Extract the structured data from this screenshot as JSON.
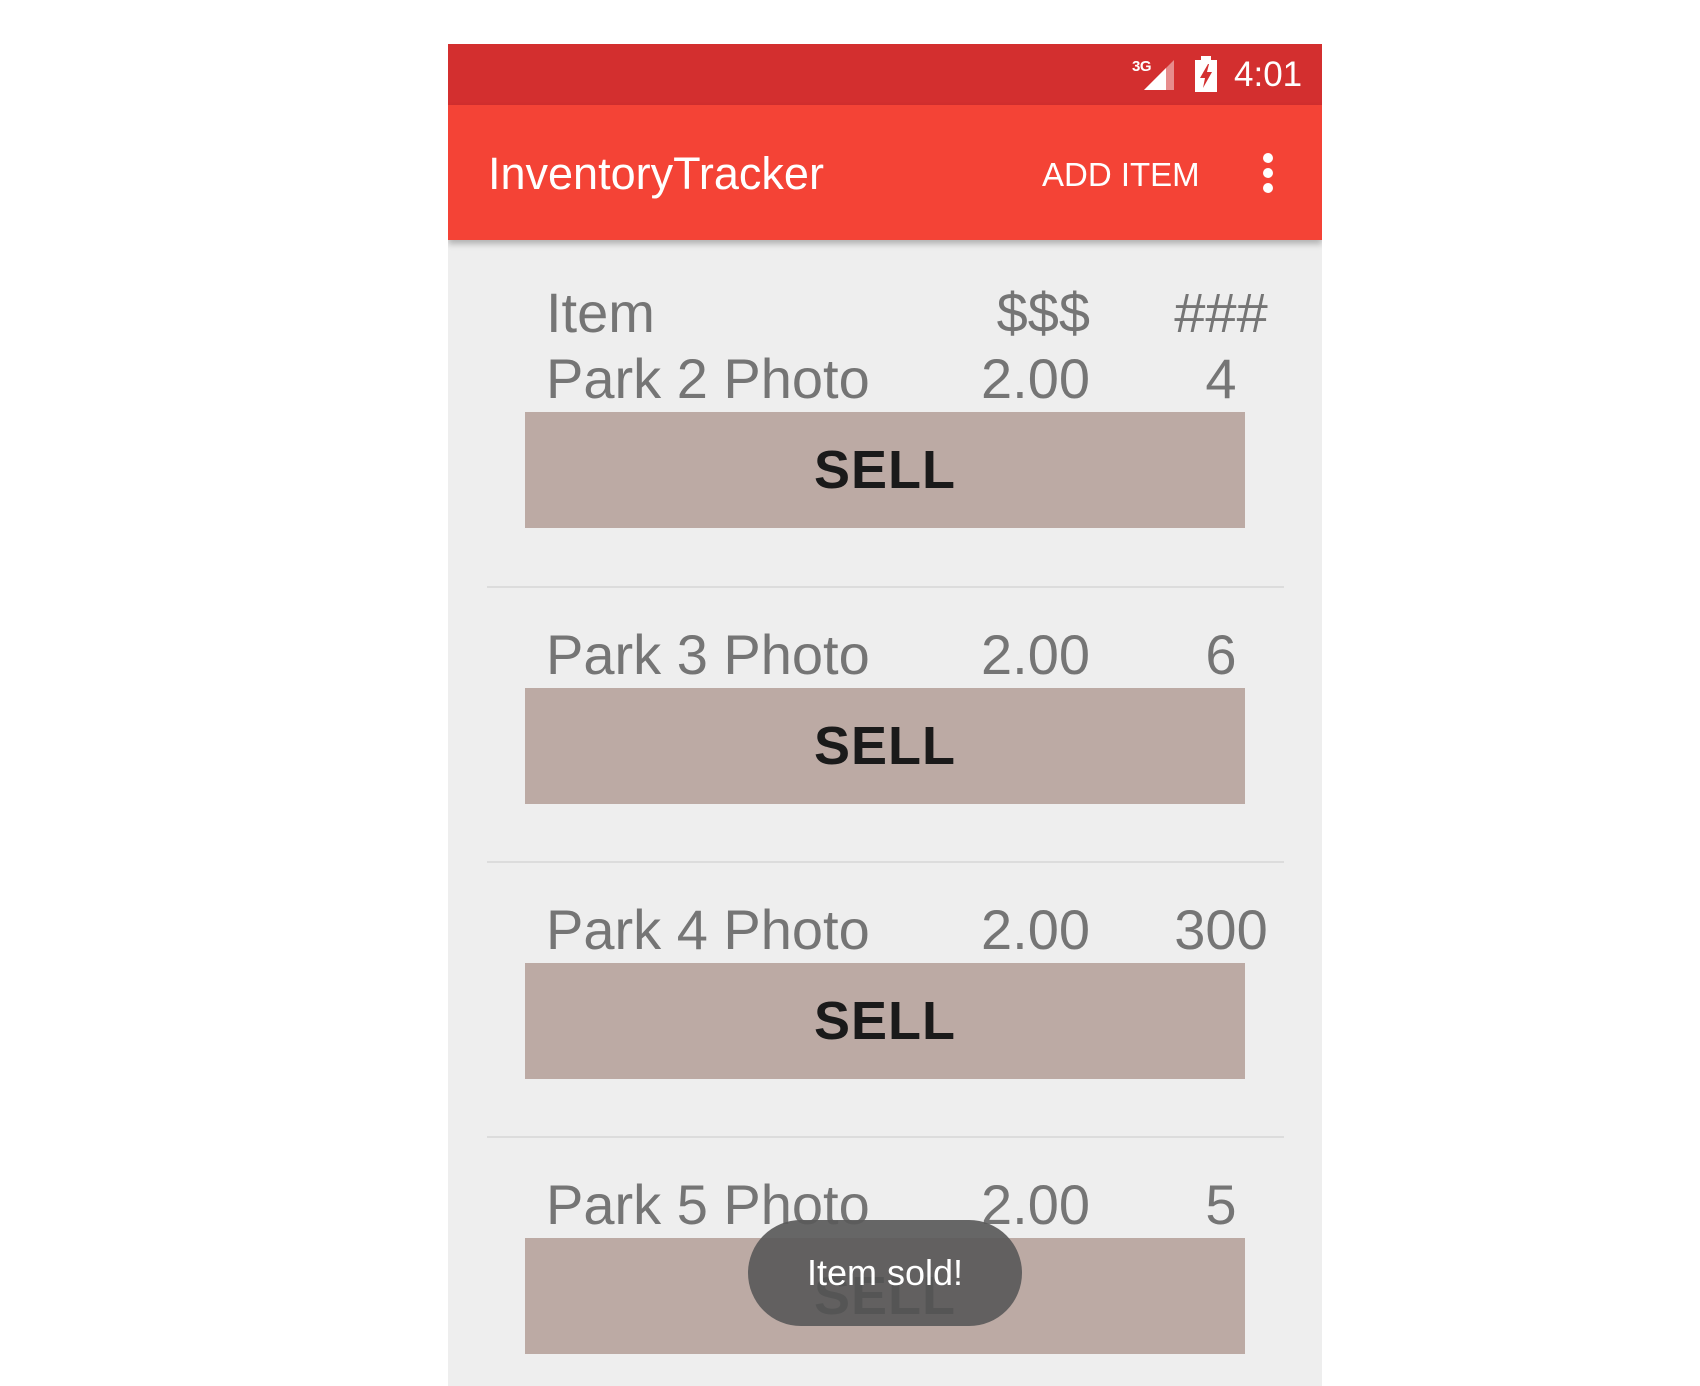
{
  "status_bar": {
    "network": "3G",
    "time": "4:01"
  },
  "app_bar": {
    "title": "InventoryTracker",
    "add_item_label": "ADD ITEM"
  },
  "table_header": {
    "item": "Item",
    "price": "$$$",
    "quantity": "###"
  },
  "items": [
    {
      "name": "Park 2 Photo",
      "price": "2.00",
      "quantity": "4",
      "sell_label": "SELL"
    },
    {
      "name": "Park 3 Photo",
      "price": "2.00",
      "quantity": "6",
      "sell_label": "SELL"
    },
    {
      "name": "Park 4 Photo",
      "price": "2.00",
      "quantity": "300",
      "sell_label": "SELL"
    },
    {
      "name": "Park 5 Photo",
      "price": "2.00",
      "quantity": "5",
      "sell_label": "SELL"
    }
  ],
  "toast": {
    "message": "Item sold!"
  },
  "colors": {
    "status_bar": "#d32f2f",
    "app_bar": "#f44336",
    "sell_button": "#bcaaa4",
    "background": "#eeeeee"
  }
}
